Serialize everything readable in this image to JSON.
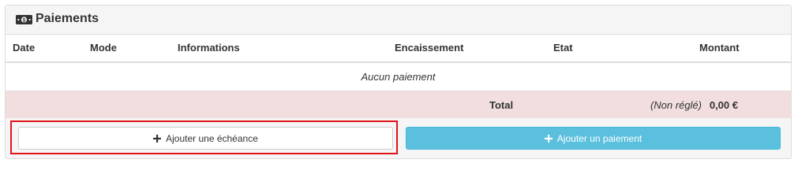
{
  "panel": {
    "title": "Paiements",
    "icon": "money-bill-icon"
  },
  "table": {
    "columns": [
      "Date",
      "Mode",
      "Informations",
      "Encaissement",
      "Etat",
      "Montant"
    ],
    "empty_message": "Aucun paiement",
    "total": {
      "label": "Total",
      "status": "(Non réglé)",
      "amount": "0,00 €"
    }
  },
  "actions": {
    "add_schedule": "Ajouter une échéance",
    "add_payment": "Ajouter un paiement"
  },
  "colors": {
    "total_row_bg": "#f2dede",
    "info_button": "#5bc0de",
    "highlight_border": "#e0141a"
  }
}
